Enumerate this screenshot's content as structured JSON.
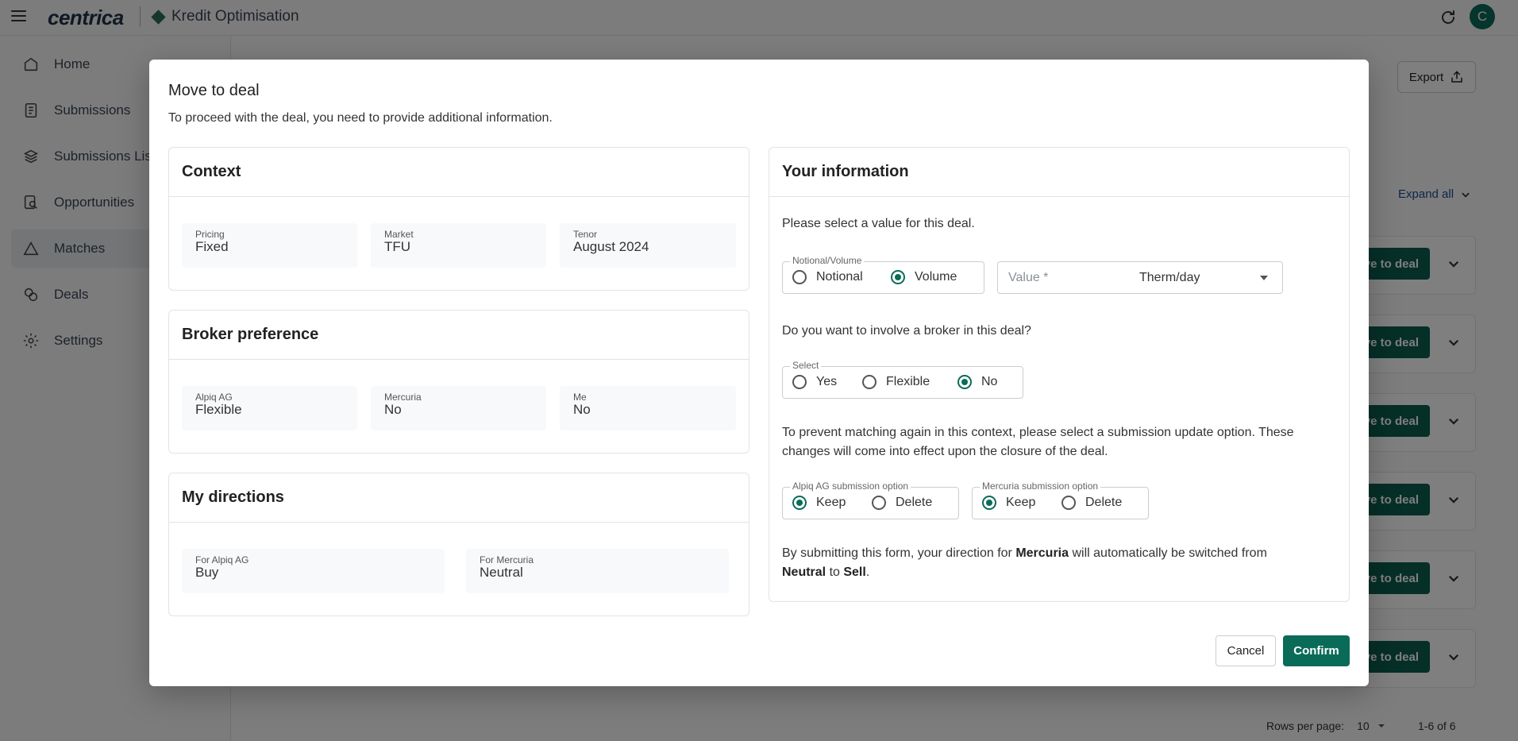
{
  "header": {
    "brand": "centrica",
    "app_name": "Kredit Optimisation",
    "avatar_initial": "C"
  },
  "sidebar": {
    "items": [
      {
        "label": "Home",
        "icon": "home-icon"
      },
      {
        "label": "Submissions",
        "icon": "document-icon"
      },
      {
        "label": "Submissions Lis",
        "icon": "layers-icon"
      },
      {
        "label": "Opportunities",
        "icon": "search-document-icon"
      },
      {
        "label": "Matches",
        "icon": "triangle-icon"
      },
      {
        "label": "Deals",
        "icon": "circles-icon"
      },
      {
        "label": "Settings",
        "icon": "gear-icon"
      }
    ],
    "active": "Matches"
  },
  "background": {
    "export_label": "Export",
    "expand_all_label": "Expand all",
    "row_button_label": "ve to deal",
    "rows_per_page_label": "Rows per page:",
    "rows_per_page_value": "10",
    "range_label": "1-6 of 6"
  },
  "modal": {
    "title": "Move to deal",
    "description": "To proceed with the deal, you need to provide additional information.",
    "context": {
      "heading": "Context",
      "fields": [
        {
          "label": "Pricing",
          "value": "Fixed"
        },
        {
          "label": "Market",
          "value": "TFU"
        },
        {
          "label": "Tenor",
          "value": "August 2024"
        }
      ]
    },
    "broker_preference": {
      "heading": "Broker preference",
      "fields": [
        {
          "label": "Alpiq AG",
          "value": "Flexible"
        },
        {
          "label": "Mercuria",
          "value": "No"
        },
        {
          "label": "Me",
          "value": "No"
        }
      ]
    },
    "directions": {
      "heading": "My directions",
      "fields": [
        {
          "label": "For Alpiq AG",
          "value": "Buy"
        },
        {
          "label": "For Mercuria",
          "value": "Neutral"
        }
      ]
    },
    "your_info": {
      "heading": "Your information",
      "value_prompt": "Please select a value for this deal.",
      "notional_volume": {
        "legend": "Notional/Volume",
        "options": [
          "Notional",
          "Volume"
        ],
        "selected": "Volume"
      },
      "value_field": {
        "placeholder": "Value *",
        "unit": "Therm/day"
      },
      "broker_prompt": "Do you want to involve a broker in this deal?",
      "broker_select": {
        "legend": "Select",
        "options": [
          "Yes",
          "Flexible",
          "No"
        ],
        "selected": "No"
      },
      "update_prompt": "To prevent matching again in this context, please select a submission update option. These changes will come into effect upon the closure of the deal.",
      "alpiq_option": {
        "legend": "Alpiq AG submission option",
        "options": [
          "Keep",
          "Delete"
        ],
        "selected": "Keep"
      },
      "mercuria_option": {
        "legend": "Mercuria submission option",
        "options": [
          "Keep",
          "Delete"
        ],
        "selected": "Keep"
      },
      "notice": {
        "part1": "By submitting this form, your direction for ",
        "counterparty": "Mercuria",
        "part2": " will automatically be switched from",
        "from": "Neutral",
        "part3": " to ",
        "to": "Sell",
        "part4": "."
      }
    },
    "cancel_label": "Cancel",
    "confirm_label": "Confirm"
  },
  "colors": {
    "accent": "#0b6b59",
    "link": "#1b4f8a"
  }
}
